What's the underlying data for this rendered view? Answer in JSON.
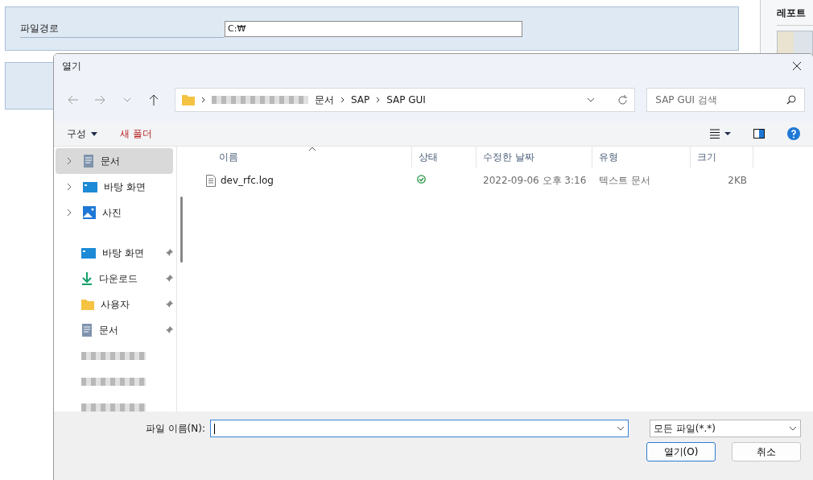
{
  "background": {
    "path_label": "파일경로",
    "path_value": "C:₩",
    "side_title": "레포트"
  },
  "dialog": {
    "title": "열기",
    "address": {
      "crumbs": [
        {
          "kind": "redacted"
        },
        {
          "kind": "text",
          "label": "문서"
        },
        {
          "kind": "text",
          "label": "SAP"
        },
        {
          "kind": "text",
          "label": "SAP GUI"
        }
      ],
      "search_placeholder": "SAP GUI 검색"
    },
    "commands": [
      {
        "label": "구성",
        "dropdown": true
      },
      {
        "label": "새 폴더",
        "dropdown": false
      }
    ],
    "nav": [
      {
        "kind": "document",
        "label": "문서",
        "selected": true,
        "expandable": true,
        "pinned": false
      },
      {
        "kind": "desktop",
        "label": "바탕 화면",
        "selected": false,
        "expandable": true,
        "pinned": false
      },
      {
        "kind": "photo",
        "label": "사진",
        "selected": false,
        "expandable": true,
        "pinned": false
      },
      {
        "kind": "divider"
      },
      {
        "kind": "desktop",
        "label": "바탕 화면",
        "selected": false,
        "expandable": false,
        "pinned": true
      },
      {
        "kind": "download",
        "label": "다운로드",
        "selected": false,
        "expandable": false,
        "pinned": true
      },
      {
        "kind": "folder",
        "label": "사용자",
        "selected": false,
        "expandable": false,
        "pinned": true
      },
      {
        "kind": "document",
        "label": "문서",
        "selected": false,
        "expandable": false,
        "pinned": true
      },
      {
        "kind": "redacted"
      },
      {
        "kind": "redacted"
      },
      {
        "kind": "redacted"
      }
    ],
    "columns": [
      "이름",
      "상태",
      "수정한 날짜",
      "유형",
      "크기"
    ],
    "files": [
      {
        "name": "dev_rfc.log",
        "synced": true,
        "modified": "2022-09-06 오후 3:16",
        "type": "텍스트 문서",
        "size": "2KB"
      }
    ],
    "filename_label": "파일 이름(N):",
    "filter": "모든 파일(*.*)",
    "buttons": [
      {
        "label": "열기(O)",
        "primary": true
      },
      {
        "label": "취소",
        "primary": false
      }
    ]
  }
}
